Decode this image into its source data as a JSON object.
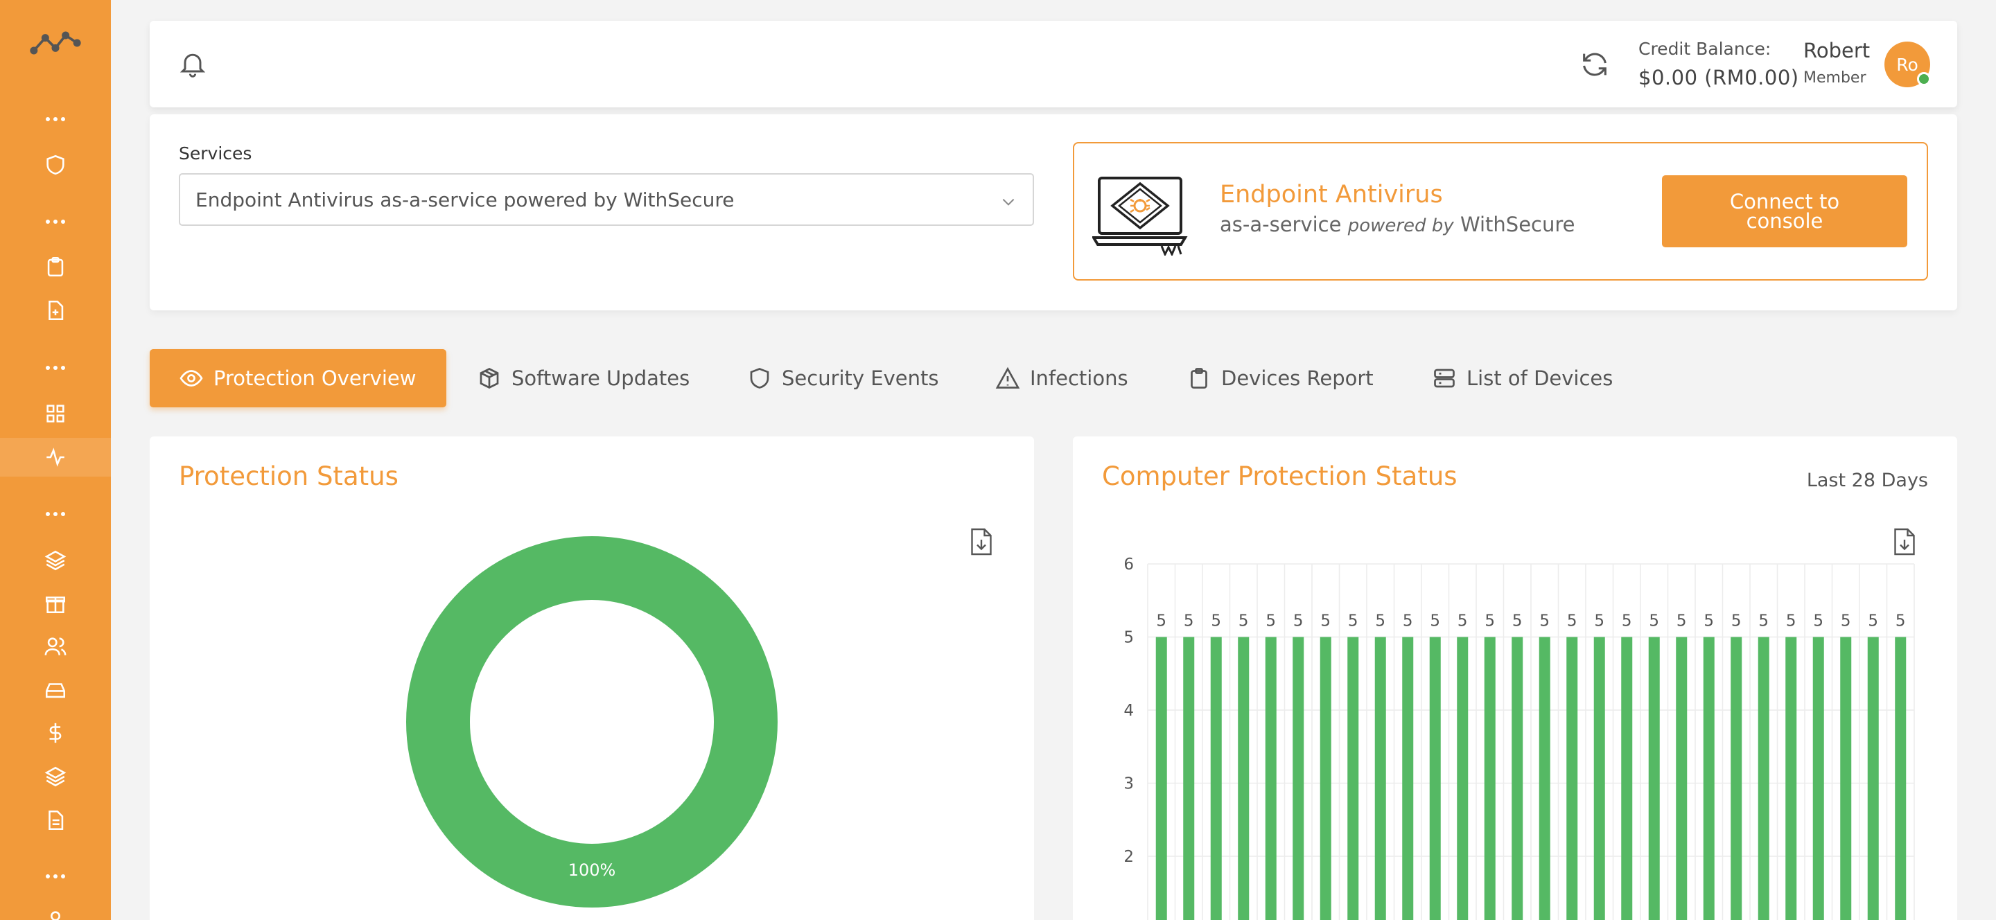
{
  "header": {
    "credit_label": "Credit Balance:",
    "credit_value": "$0.00 (RM0.00)",
    "user_name": "Robert",
    "user_role": "Member",
    "avatar_initials": "Ro"
  },
  "services": {
    "label": "Services",
    "selected": "Endpoint Antivirus as-a-service powered by WithSecure"
  },
  "product": {
    "title": "Endpoint Antivirus",
    "subtitle_prefix": "as-a-service",
    "subtitle_powered": "powered by",
    "subtitle_vendor": "WithSecure",
    "connect_label": "Connect to console"
  },
  "tabs": [
    {
      "label": "Protection Overview",
      "icon": "eye-icon",
      "active": true
    },
    {
      "label": "Software Updates",
      "icon": "box-icon"
    },
    {
      "label": "Security Events",
      "icon": "shield-icon"
    },
    {
      "label": "Infections",
      "icon": "warning-icon"
    },
    {
      "label": "Devices Report",
      "icon": "clipboard-icon"
    },
    {
      "label": "List of Devices",
      "icon": "server-icon"
    }
  ],
  "protection_status": {
    "title": "Protection Status",
    "chart_data": {
      "type": "pie",
      "slices": [
        {
          "value": 100,
          "color": "#55b964"
        }
      ],
      "labels": [
        "100%"
      ]
    }
  },
  "computer_protection": {
    "title": "Computer Protection Status",
    "period": "Last 28 Days",
    "chart_data": {
      "type": "bar",
      "yticks": [
        "2",
        "3",
        "4",
        "5",
        "6"
      ],
      "ylim": [
        0,
        6
      ],
      "values": [
        5,
        5,
        5,
        5,
        5,
        5,
        5,
        5,
        5,
        5,
        5,
        5,
        5,
        5,
        5,
        5,
        5,
        5,
        5,
        5,
        5,
        5,
        5,
        5,
        5,
        5,
        5,
        5
      ],
      "bar_color": "#55b964",
      "grid": true
    }
  },
  "colors": {
    "accent": "#f29a3a",
    "success": "#55b964"
  }
}
